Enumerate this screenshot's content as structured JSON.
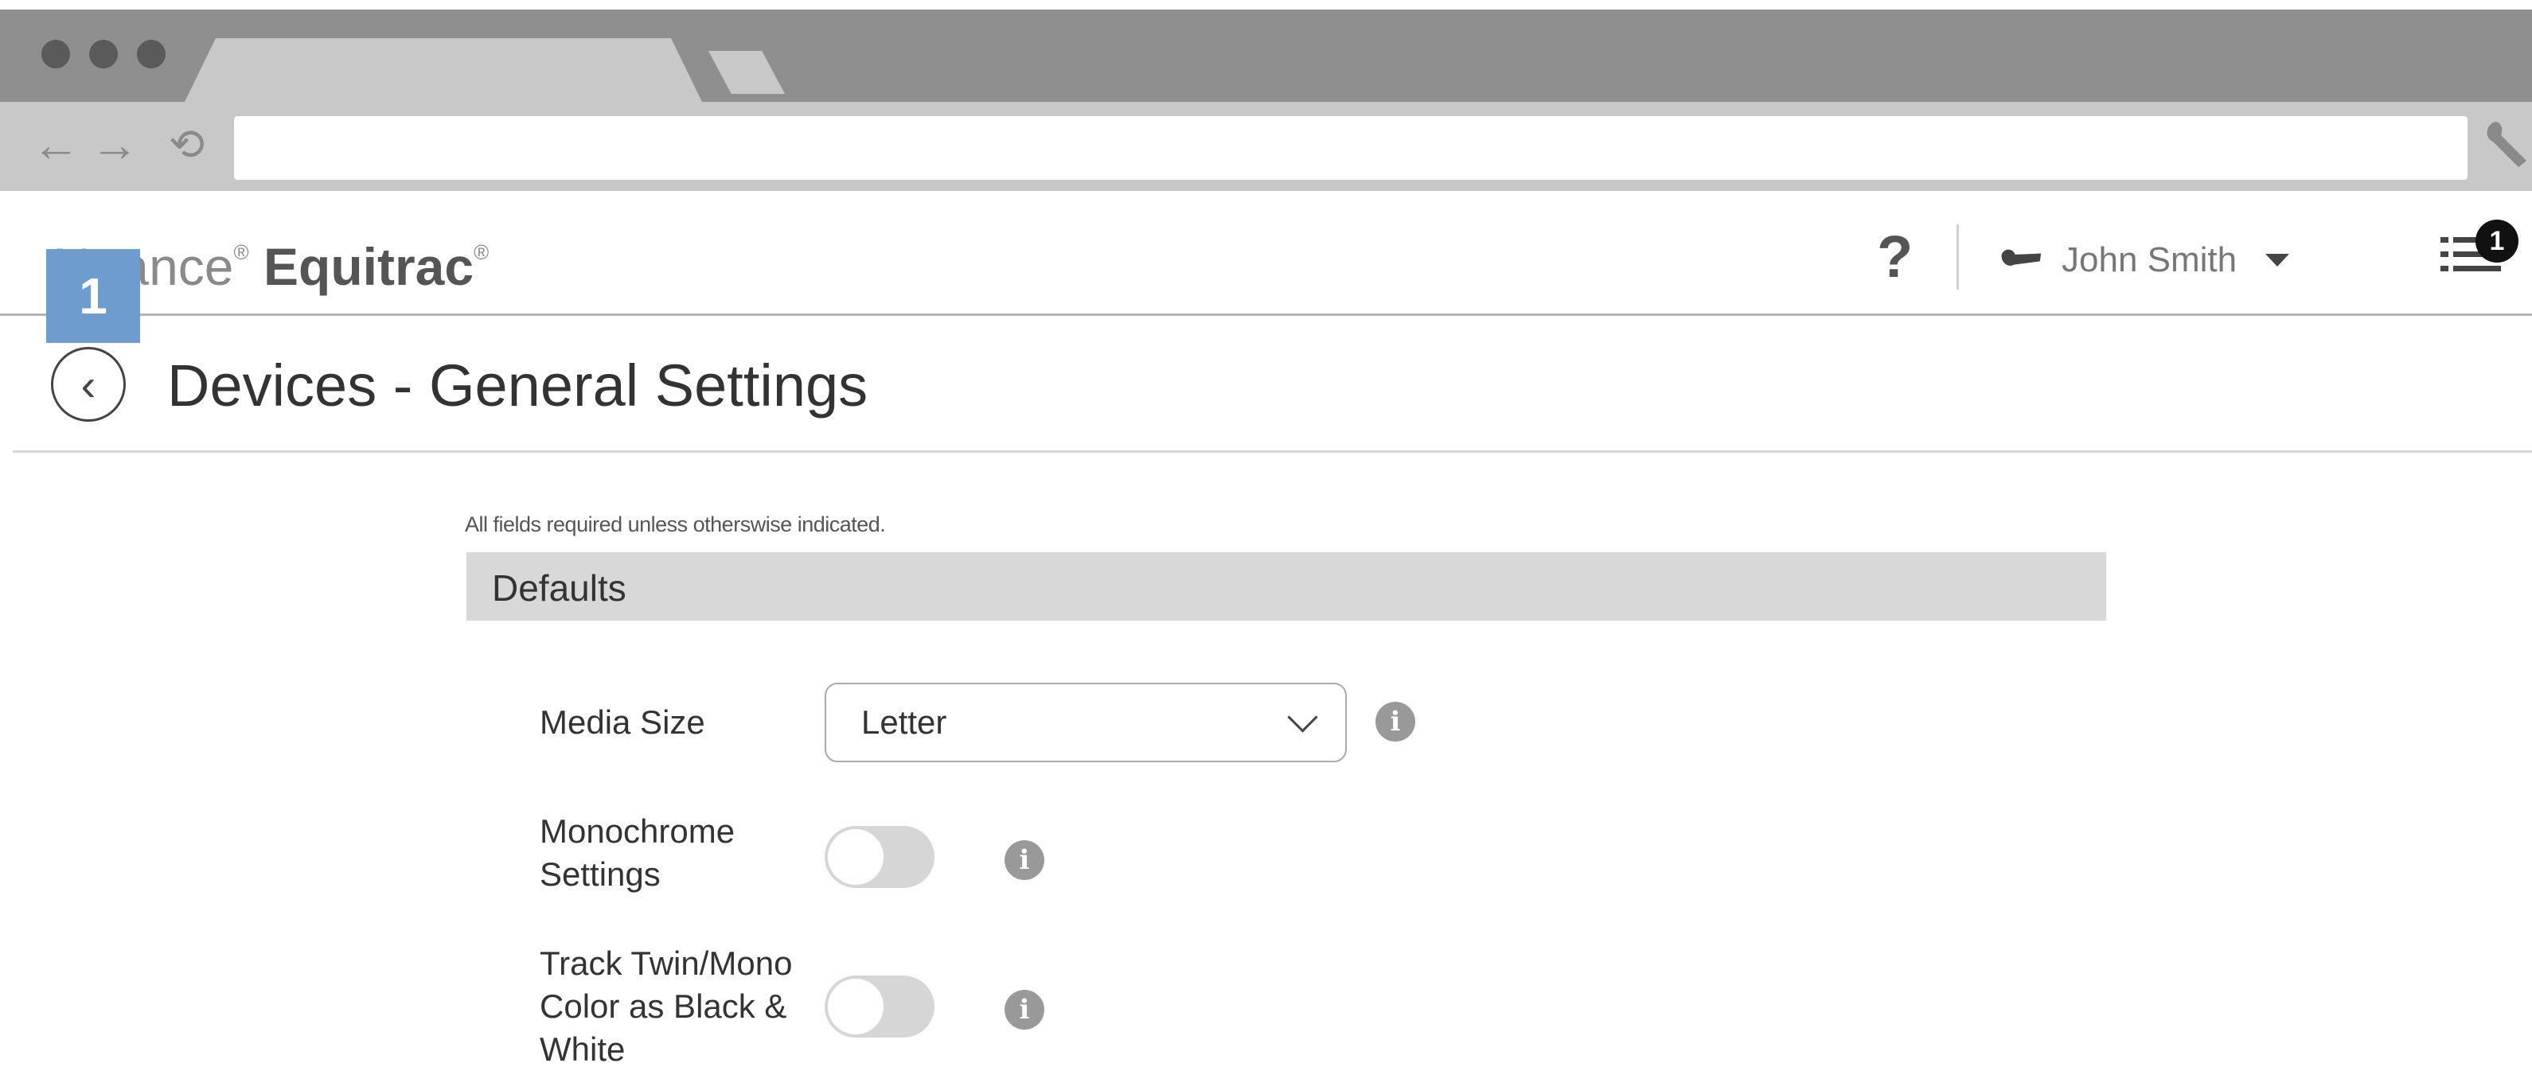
{
  "browser": {
    "back_glyph": "←",
    "forward_glyph": "→",
    "reload_glyph": "⟲",
    "wrench_glyph": "🔧",
    "address": ""
  },
  "header": {
    "logo_light": "Nuance",
    "logo_reg": "®",
    "logo_bold": "Equitrac",
    "logo_reg2": "®",
    "help_label": "?",
    "user_name": "John Smith",
    "notification_count": "1",
    "step_badge": "1"
  },
  "page": {
    "back_glyph": "‹",
    "title": "Devices - General Settings"
  },
  "form": {
    "required_note": "All fields required unless otherswise indicated.",
    "section_title": "Defaults",
    "media_size": {
      "label": "Media Size",
      "value": "Letter"
    },
    "monochrome": {
      "label_line1": "Monochrome",
      "label_line2": "Settings",
      "enabled": false
    },
    "track_twin": {
      "label_line1": "Track Twin/Mono",
      "label_line2": "Color as Black &",
      "label_line3": "White",
      "enabled": false
    }
  },
  "colors": {
    "accent_badge": "#6e9ccf",
    "chrome": "#8f8f8f",
    "toolbar": "#c8c8c8",
    "section_bg": "#d8d8d8"
  }
}
